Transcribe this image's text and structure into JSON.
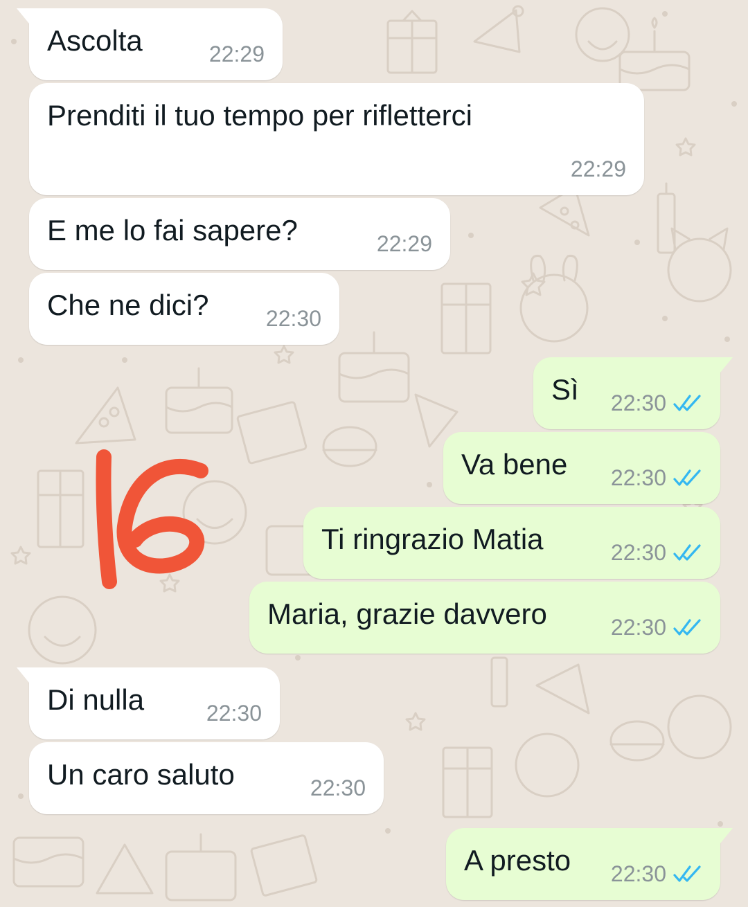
{
  "colors": {
    "background": "#ece5dd",
    "incoming_bubble": "#ffffff",
    "outgoing_bubble": "#e7fdd3",
    "text": "#111b21",
    "timestamp": "#8a9398",
    "read_ticks": "#34b7f1",
    "annotation": "#f05538"
  },
  "messages": [
    {
      "direction": "in",
      "text": "Ascolta",
      "time": "22:29"
    },
    {
      "direction": "in",
      "text": "Prenditi il tuo tempo per rifletterci",
      "time": "22:29"
    },
    {
      "direction": "in",
      "text": "E me lo fai sapere?",
      "time": "22:29"
    },
    {
      "direction": "in",
      "text": "Che ne dici?",
      "time": "22:30"
    },
    {
      "direction": "out",
      "text": "Sì",
      "time": "22:30",
      "status": "read",
      "status_icon": "double-check-icon"
    },
    {
      "direction": "out",
      "text": "Va bene",
      "time": "22:30",
      "status": "read",
      "status_icon": "double-check-icon"
    },
    {
      "direction": "out",
      "text": "Ti ringrazio Matia",
      "time": "22:30",
      "status": "read",
      "status_icon": "double-check-icon"
    },
    {
      "direction": "out",
      "text": "Maria, grazie davvero",
      "time": "22:30",
      "status": "read",
      "status_icon": "double-check-icon"
    },
    {
      "direction": "in",
      "text": "Di nulla",
      "time": "22:30"
    },
    {
      "direction": "in",
      "text": "Un caro saluto",
      "time": "22:30"
    },
    {
      "direction": "out",
      "text": "A presto",
      "time": "22:30",
      "status": "read",
      "status_icon": "double-check-icon"
    }
  ],
  "annotation": {
    "text": "16"
  }
}
